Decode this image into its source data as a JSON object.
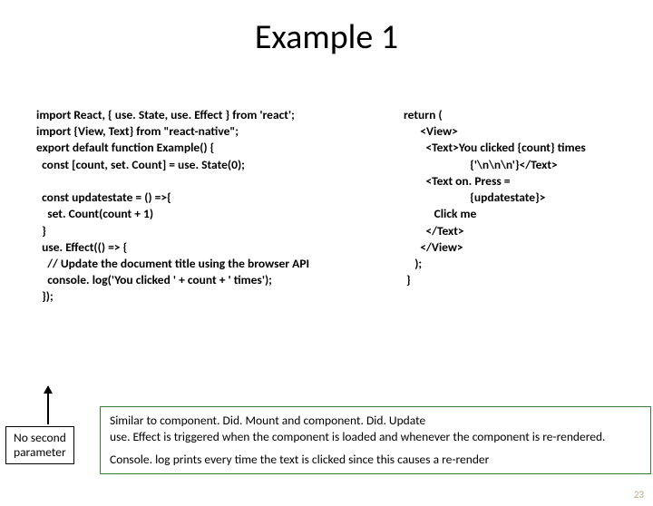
{
  "title": "Example 1",
  "code_left": "import React, { use. State, use. Effect } from 'react';\nimport {View, Text} from \"react-native\";\nexport default function Example() {\n  const [count, set. Count] = use. State(0);\n\n  const updatestate = () =>{\n    set. Count(count + 1)\n  }\n  use. Effect(() => {\n    // Update the document title using the browser API\n    console. log('You clicked ' + count + ' times');\n  });",
  "code_right": "return (\n      <View>\n        <Text>You clicked {count} times\n                        {'\\n\\n\\n'}</Text>\n        <Text on. Press =\n                        {updatestate}>\n           Click me\n        </Text>\n      </View>\n    );\n }",
  "note_p1": "Similar to component. Did. Mount and component. Did. Update",
  "note_p2": "use. Effect is triggered when the component is loaded and whenever the component is re-rendered.",
  "note_p3": "Console. log prints every time the text is clicked since this causes a re-render",
  "label_line1": "No second",
  "label_line2": "parameter",
  "slide_number": "23"
}
